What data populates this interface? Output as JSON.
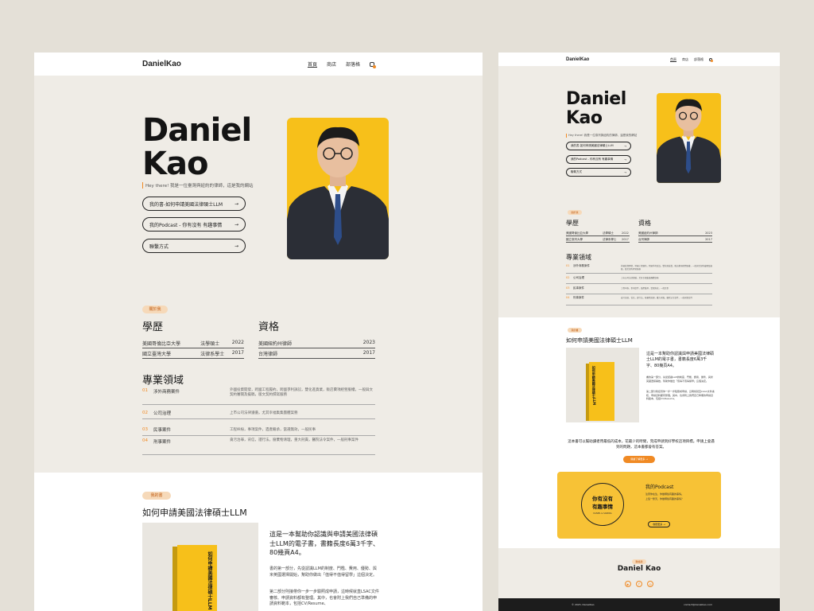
{
  "site": {
    "logo": "DanielKao",
    "nav": [
      "首頁",
      "商店",
      "部落格"
    ]
  },
  "hero": {
    "name_line1": "Daniel",
    "name_line2": "Kao",
    "tagline": "Hey there! 我是一位臺灣與紐約的律師，這是我的網站",
    "buttons": [
      "我的書-如何申請美國法律碩士LLM",
      "我的Podcast - 你有沒有 有趣事情",
      "聯繫方式"
    ],
    "arrow": "→"
  },
  "about": {
    "badge": "關於我",
    "edu_title": "學歷",
    "cert_title": "資格",
    "edu": [
      {
        "school": "美國哥倫比亞大學",
        "degree": "法學碩士",
        "year": "2022"
      },
      {
        "school": "國立臺灣大學",
        "degree": "法律系學士",
        "year": "2017"
      }
    ],
    "certs": [
      {
        "name": "美國紐約州律師",
        "year": "2023"
      },
      {
        "name": "台灣律師",
        "year": "2017"
      }
    ],
    "practice_title": "專業領域",
    "practice": [
      {
        "num": "01",
        "name": "涉外商務案件",
        "desc": "外國投資開發，跨國工程履約，跨國爭利訴訟，雙化進貨業，販店費項經營服權，一般與文契約審閱及擬稿，版文契約撰寫服務"
      },
      {
        "num": "02",
        "name": "公司治理",
        "desc": "上市公司法律遵循，尤其幸福集集團體案務"
      },
      {
        "num": "03",
        "name": "民事案件",
        "desc": "工程糾紛，事項案件，遺產繼承，當選無效，一般民事"
      },
      {
        "num": "04",
        "name": "刑事案件",
        "desc": "貪污治罪，背信，證行法，廢棄物清理，重大刑責，醫院法令案件，一般刑事案件"
      }
    ]
  },
  "book": {
    "badge": "我的書",
    "title": "如何申請美國法律碩士LLM",
    "headline": "這是一本幫助你認識與申請美國法律碩士LLM的電子書，書籍長度6萬3千字、80幾頁A4。",
    "p1": "書的第一部分，先從認識LLM的制度、門檻、費用、優勢、與米英國選擇開始，幫助你做出「值得不值得留學」這個決定。",
    "p2": "第二部分則接帶你一步一步驗照成申請，這時候就直LSAC文件審核、申請資料都有整理。其中，也會附上我們自己準備的申請資料範本，包括CV/Resume、",
    "cover_text": "如何申請美國法律碩士LLM",
    "cta_text": "這本書可以幫助讀者用最低的成本，花最少的時間，完成申請到好學校這項目標。申請上會遇到的問題，這本書都會有答案。",
    "cta_button": "閱讀了解更多 →"
  },
  "podcast": {
    "title": "我的Podcast",
    "cover_line1": "你有沒有",
    "cover_line2": "有趣事情",
    "cover_sub": "DANIEL & SANDRA",
    "desc1": "注意你在生，你做哪些有趣的事情。",
    "desc2": "上班一整天，你做哪些有趣的事情？",
    "button": "收聽更多 →"
  },
  "contact": {
    "badge": "聯絡我",
    "name": "Daniel Kao"
  },
  "footer": {
    "copyright": "© 2023, DanielKao",
    "email": "contact@danielkao.com"
  },
  "colors": {
    "accent": "#f08a24",
    "yellow": "#f7c01a",
    "bg": "#efece6"
  }
}
